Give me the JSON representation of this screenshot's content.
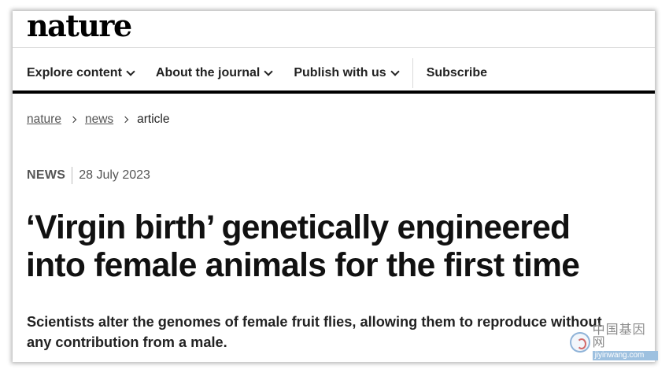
{
  "masthead": {
    "logo": "nature"
  },
  "nav": {
    "items": [
      {
        "label": "Explore content",
        "has_dropdown": true
      },
      {
        "label": "About the journal",
        "has_dropdown": true
      },
      {
        "label": "Publish with us",
        "has_dropdown": true
      },
      {
        "label": "Subscribe",
        "has_dropdown": false
      }
    ]
  },
  "breadcrumb": {
    "items": [
      {
        "label": "nature",
        "link": true
      },
      {
        "label": "news",
        "link": true
      },
      {
        "label": "article",
        "link": false
      }
    ]
  },
  "article": {
    "type": "NEWS",
    "date": "28 July 2023",
    "title_line1": "‘Virgin birth’ genetically engineered",
    "title_line2": "into female animals for the first time",
    "standfirst_line1": "Scientists alter the genomes of female fruit flies, allowing them to reproduce without",
    "standfirst_line2": "any contribution from a male."
  },
  "watermark": {
    "text_cn": "中国基因网",
    "url": "jiyinwang.com"
  },
  "colors": {
    "text": "#222222",
    "rule": "#000000",
    "muted": "#555555"
  }
}
